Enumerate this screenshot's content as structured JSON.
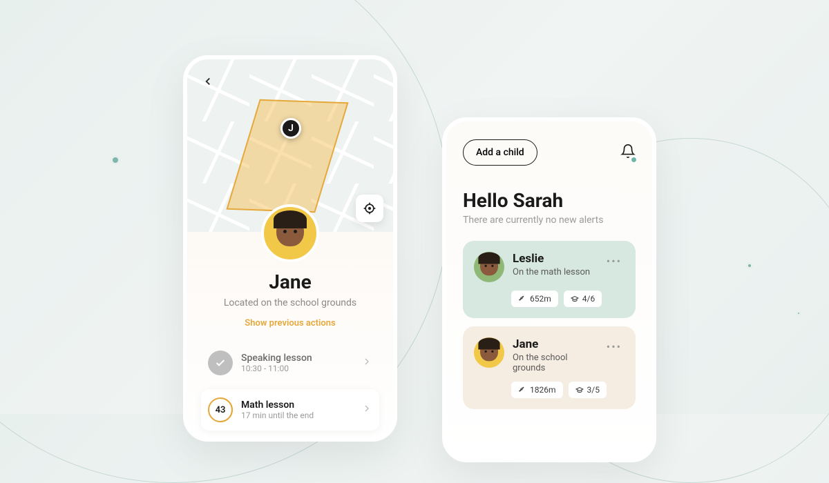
{
  "left_phone": {
    "marker_initial": "J",
    "child_name": "Jane",
    "location_text": "Located on the school grounds",
    "show_prev_label": "Show previous actions",
    "lessons": [
      {
        "title": "Speaking lesson",
        "sub": "10:30 - 11:00",
        "state": "completed"
      },
      {
        "title": "Math lesson",
        "sub": "17 min until the end",
        "state": "current",
        "count": "43"
      }
    ]
  },
  "right_phone": {
    "add_child_label": "Add a child",
    "greeting": "Hello Sarah",
    "alerts_sub": "There are currently no new alerts",
    "children": [
      {
        "name": "Leslie",
        "status": "On the math lesson",
        "distance": "652m",
        "progress": "4/6",
        "avatar_tint": "g"
      },
      {
        "name": "Jane",
        "status": "On the school grounds",
        "distance": "1826m",
        "progress": "3/5",
        "avatar_tint": "y"
      }
    ]
  }
}
